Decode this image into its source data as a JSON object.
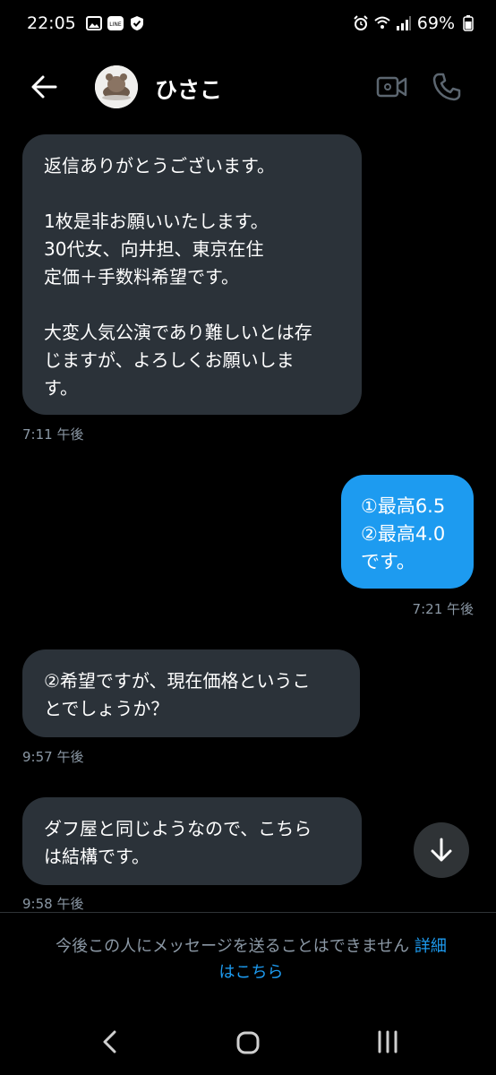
{
  "status_bar": {
    "time": "22:05",
    "battery": "69%",
    "left_icons": [
      "gallery-icon",
      "line-icon",
      "shield-check-icon"
    ],
    "right_icons": [
      "alarm-icon",
      "wifi-icon",
      "signal-icon",
      "battery-icon"
    ]
  },
  "header": {
    "contact_name": "ひさこ",
    "back_icon": "arrow-left-icon",
    "video_icon": "video-call-icon",
    "call_icon": "phone-icon"
  },
  "messages": [
    {
      "direction": "received",
      "text": "返信ありがとうございます。\n\n1枚是非お願いいたします。\n30代女、向井担、東京在住\n定価＋手数料希望です。\n\n大変人気公演であり難しいとは存\nじますが、よろしくお願いしま\nす。",
      "time": "7:11 午後"
    },
    {
      "direction": "sent",
      "text": "①最高6.5\n②最高4.0\nです。",
      "time": "7:21 午後"
    },
    {
      "direction": "received",
      "text": "②希望ですが、現在価格というこ\nとでしょうか？",
      "time": "9:57 午後"
    },
    {
      "direction": "received",
      "text": "ダフ屋と同じようなので、こちら\nは結構です。",
      "time": "9:58 午後"
    }
  ],
  "footer": {
    "notice": "今後この人にメッセージを送ることはできません",
    "link_part1": "詳細",
    "link_part2": "はこちら"
  },
  "colors": {
    "background": "#000000",
    "received_bubble": "#2b3239",
    "sent_bubble": "#1d9bf0",
    "link": "#1d9bf0",
    "secondary_text": "#8b98a5"
  }
}
